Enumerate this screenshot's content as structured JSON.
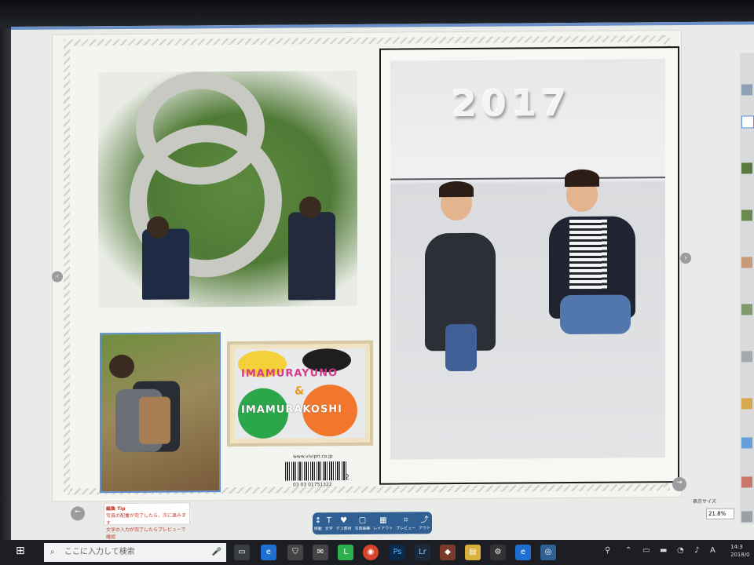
{
  "page_image": {
    "year_text": "2017",
    "craft_top": "IMAMURAYUNO",
    "craft_amp": "&",
    "craft_bottom": "IMAMURAKOSHI",
    "url_text": "www.vivipri.co.jp",
    "barcode_number": "03 03 01751322",
    "page_number": "2"
  },
  "tip": {
    "title": "編集 Tip",
    "line1": "写真の配置が完了したら、次に進みます",
    "line2": "文字の入力が完了したらプレビューで確認"
  },
  "toolbar": {
    "items": [
      {
        "icon": "↕",
        "label": "移動"
      },
      {
        "icon": "T",
        "label": "文字"
      },
      {
        "icon": "♥",
        "label": "デコ素材"
      },
      {
        "icon": "▢",
        "label": "写真編集"
      },
      {
        "icon": "▦",
        "label": "レイアウト"
      },
      {
        "icon": "⌗",
        "label": "プレビュー"
      },
      {
        "icon": "⤴",
        "label": "アウト"
      }
    ]
  },
  "zoom": {
    "label": "表示サイズ",
    "value": "21.8%"
  },
  "taskbar": {
    "search_placeholder": "ここに入力して検索",
    "clock_time": "14:3",
    "clock_date": "2018/0"
  },
  "colors": {
    "accent": "#2f5f93",
    "frame_blue": "#5c8fcf",
    "green_blob": "#2ba64a",
    "orange_blob": "#f2772d",
    "yellow_blob": "#f3d13b"
  }
}
